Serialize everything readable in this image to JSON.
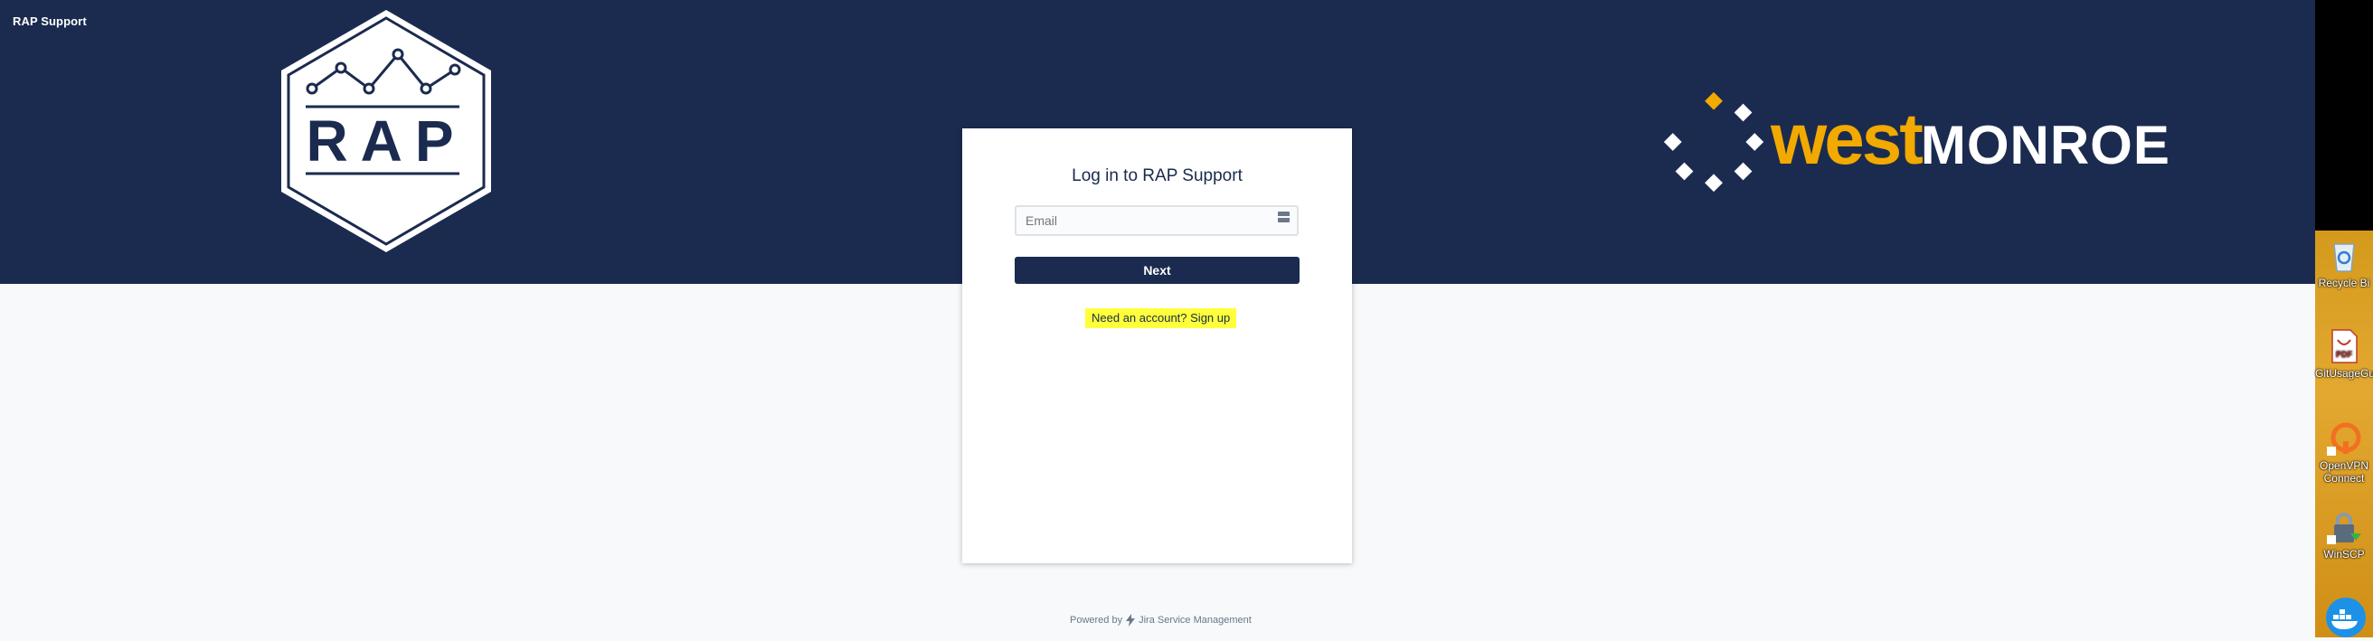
{
  "header": {
    "site_title": "RAP Support",
    "rap_logo_text": "RAP",
    "partner_logo": {
      "west": "west",
      "monroe": "MONROE"
    }
  },
  "login": {
    "title": "Log in to RAP Support",
    "email_placeholder": "Email",
    "next_label": "Next",
    "signup_text": "Need an account? Sign up"
  },
  "footer": {
    "powered_by": "Powered by",
    "product": "Jira Service Management"
  },
  "desktop": {
    "icons": [
      {
        "label": "Recycle Bi",
        "icon": "recycle-bin-icon"
      },
      {
        "label": "GitUsageGu",
        "icon": "pdf-icon"
      },
      {
        "label": "OpenVPN Connect",
        "icon": "openvpn-icon"
      },
      {
        "label": "WinSCP",
        "icon": "winscp-icon"
      },
      {
        "label": "",
        "icon": "docker-icon"
      }
    ]
  },
  "colors": {
    "header_bg": "#1b2b4f",
    "accent_orange": "#f2a900",
    "highlight_yellow": "#ffff3b"
  }
}
